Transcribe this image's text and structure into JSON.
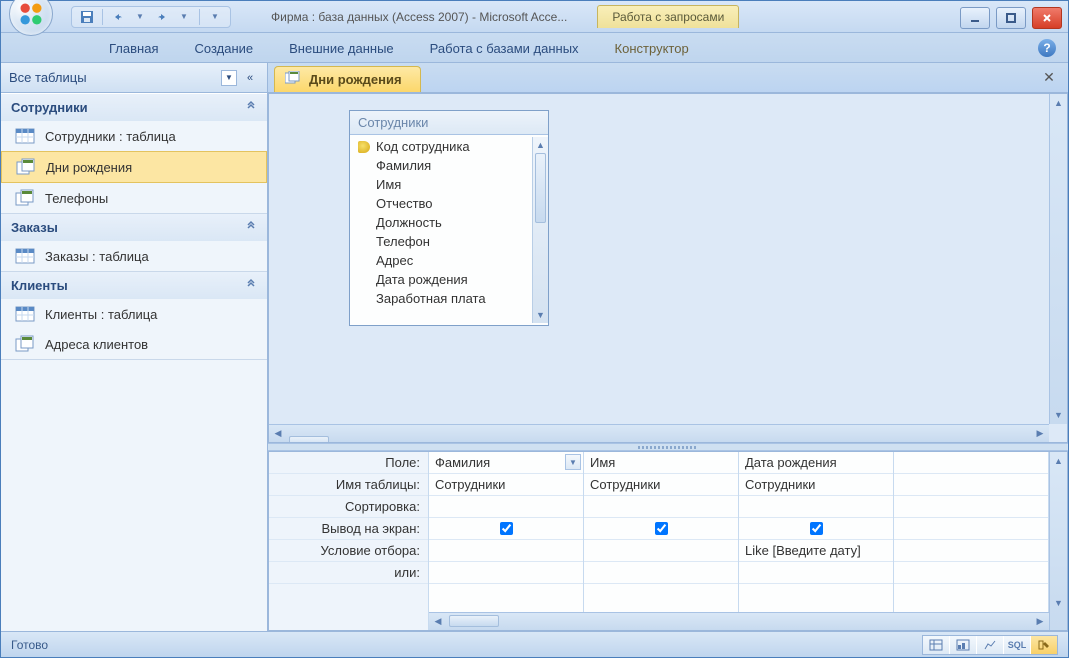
{
  "titlebar": {
    "title": "Фирма : база данных (Access 2007)  -  Microsoft Acce...",
    "context_tab": "Работа с запросами"
  },
  "ribbon": {
    "tabs": [
      "Главная",
      "Создание",
      "Внешние данные",
      "Работа с базами данных",
      "Конструктор"
    ]
  },
  "navpane": {
    "header": "Все таблицы",
    "groups": [
      {
        "title": "Сотрудники",
        "items": [
          {
            "label": "Сотрудники : таблица",
            "type": "table"
          },
          {
            "label": "Дни рождения",
            "type": "query",
            "selected": true
          },
          {
            "label": "Телефоны",
            "type": "query"
          }
        ]
      },
      {
        "title": "Заказы",
        "items": [
          {
            "label": "Заказы : таблица",
            "type": "table"
          }
        ]
      },
      {
        "title": "Клиенты",
        "items": [
          {
            "label": "Клиенты : таблица",
            "type": "table"
          },
          {
            "label": "Адреса клиентов",
            "type": "query"
          }
        ]
      }
    ]
  },
  "doc": {
    "tab_label": "Дни рождения",
    "table_box": {
      "title": "Сотрудники",
      "fields": [
        "Код сотрудника",
        "Фамилия",
        "Имя",
        "Отчество",
        "Должность",
        "Телефон",
        "Адрес",
        "Дата рождения",
        "Заработная плата"
      ],
      "key_field_index": 0
    },
    "grid": {
      "row_labels": [
        "Поле:",
        "Имя таблицы:",
        "Сортировка:",
        "Вывод на экран:",
        "Условие отбора:",
        "или:"
      ],
      "columns": [
        {
          "field": "Фамилия",
          "table": "Сотрудники",
          "sort": "",
          "show": true,
          "criteria": "",
          "or": "",
          "has_dd": true
        },
        {
          "field": "Имя",
          "table": "Сотрудники",
          "sort": "",
          "show": true,
          "criteria": "",
          "or": ""
        },
        {
          "field": "Дата рождения",
          "table": "Сотрудники",
          "sort": "",
          "show": true,
          "criteria": "Like [Введите дату]",
          "or": ""
        }
      ]
    }
  },
  "statusbar": {
    "text": "Готово",
    "sql_label": "SQL"
  }
}
